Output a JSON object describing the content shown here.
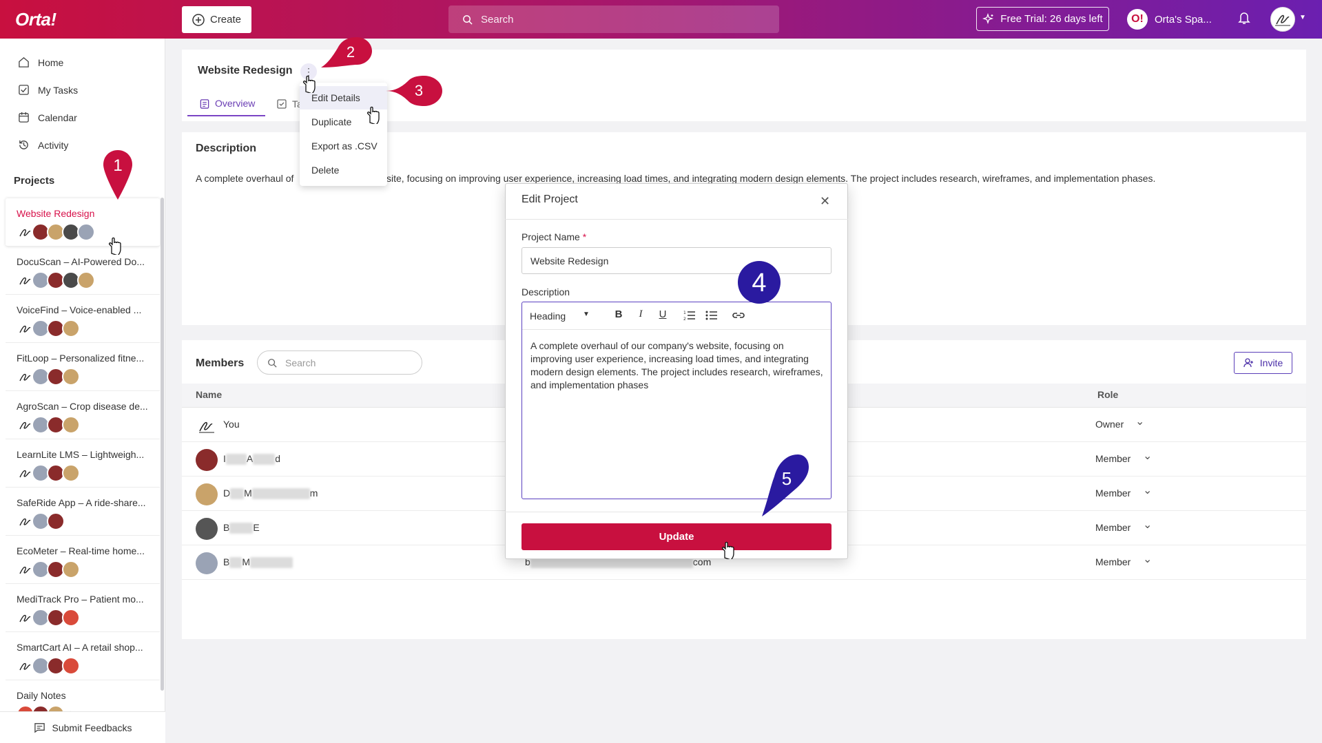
{
  "brand": {
    "logo": "Orta!",
    "accent": "#c8103f",
    "purple": "#6b1fb0"
  },
  "topbar": {
    "create_label": "Create",
    "search_placeholder": "Search",
    "trial_label": "Free Trial: 26 days left",
    "workspace_label": "Orta's Spa...",
    "workspace_icon": "O!"
  },
  "sidebar": {
    "nav": [
      {
        "label": "Home",
        "icon": "home-icon"
      },
      {
        "label": "My Tasks",
        "icon": "checkbox-icon"
      },
      {
        "label": "Calendar",
        "icon": "calendar-icon"
      },
      {
        "label": "Activity",
        "icon": "history-icon"
      }
    ],
    "projects_heading": "Projects",
    "projects": [
      {
        "name": "Website Redesign",
        "selected": true
      },
      {
        "name": "DocuScan – AI-Powered Do..."
      },
      {
        "name": "VoiceFind – Voice-enabled ..."
      },
      {
        "name": "FitLoop – Personalized fitne..."
      },
      {
        "name": "AgroScan – Crop disease de..."
      },
      {
        "name": "LearnLite LMS – Lightweigh..."
      },
      {
        "name": "SafeRide App – A ride-share..."
      },
      {
        "name": "EcoMeter – Real-time home..."
      },
      {
        "name": "MediTrack Pro – Patient mo..."
      },
      {
        "name": "SmartCart AI – A retail shop..."
      },
      {
        "name": "Daily Notes"
      }
    ],
    "feedback_label": "Submit Feedbacks"
  },
  "project": {
    "title": "Website Redesign",
    "tabs": [
      {
        "label": "Overview"
      },
      {
        "label": "Ta"
      }
    ],
    "description_heading": "Description",
    "description": "A complete overhaul of our company's website, focusing on improving user experience, increasing load times, and integrating modern design elements. The project includes research, wireframes, and implementation phases.",
    "description_left": "A complete overhaul of",
    "description_right": "site, focusing on improving user experience, increasing load times, and integrating modern design elements. The project includes research, wireframes, and implementation phases."
  },
  "menu": {
    "items": [
      {
        "label": "Edit Details"
      },
      {
        "label": "Duplicate"
      },
      {
        "label": "Export as .CSV"
      },
      {
        "label": "Delete"
      }
    ]
  },
  "members": {
    "heading": "Members",
    "search_placeholder": "Search",
    "invite_label": "Invite",
    "col_name": "Name",
    "col_role": "Role",
    "rows": [
      {
        "name_a": "You",
        "name_b": "",
        "name_c": "",
        "email_a": "",
        "email_b": "",
        "role": "Owner"
      },
      {
        "name_a": "I",
        "name_b": "A",
        "name_c": "d",
        "email_a": "",
        "email_b": "",
        "role": "Member"
      },
      {
        "name_a": "D",
        "name_b": "M",
        "name_c": "m",
        "email_a": "",
        "email_b": "",
        "role": "Member"
      },
      {
        "name_a": "B",
        "name_b": "E",
        "name_c": "",
        "email_a": "",
        "email_b": "",
        "role": "Member"
      },
      {
        "name_a": "B",
        "name_b": "M",
        "name_c": "",
        "email_a": "b",
        "email_b": "com",
        "role": "Member"
      }
    ]
  },
  "modal": {
    "title": "Edit Project",
    "name_label": "Project Name",
    "required_mark": "*",
    "name_value": "Website Redesign",
    "desc_label": "Description",
    "heading_select": "Heading",
    "editor_text": "A complete overhaul of our company's website, focusing on improving user experience, increasing load times, and integrating modern design elements. The project includes research, wireframes, and implementation phases",
    "update_label": "Update"
  },
  "callouts": [
    "1",
    "2",
    "3",
    "4",
    "5"
  ]
}
